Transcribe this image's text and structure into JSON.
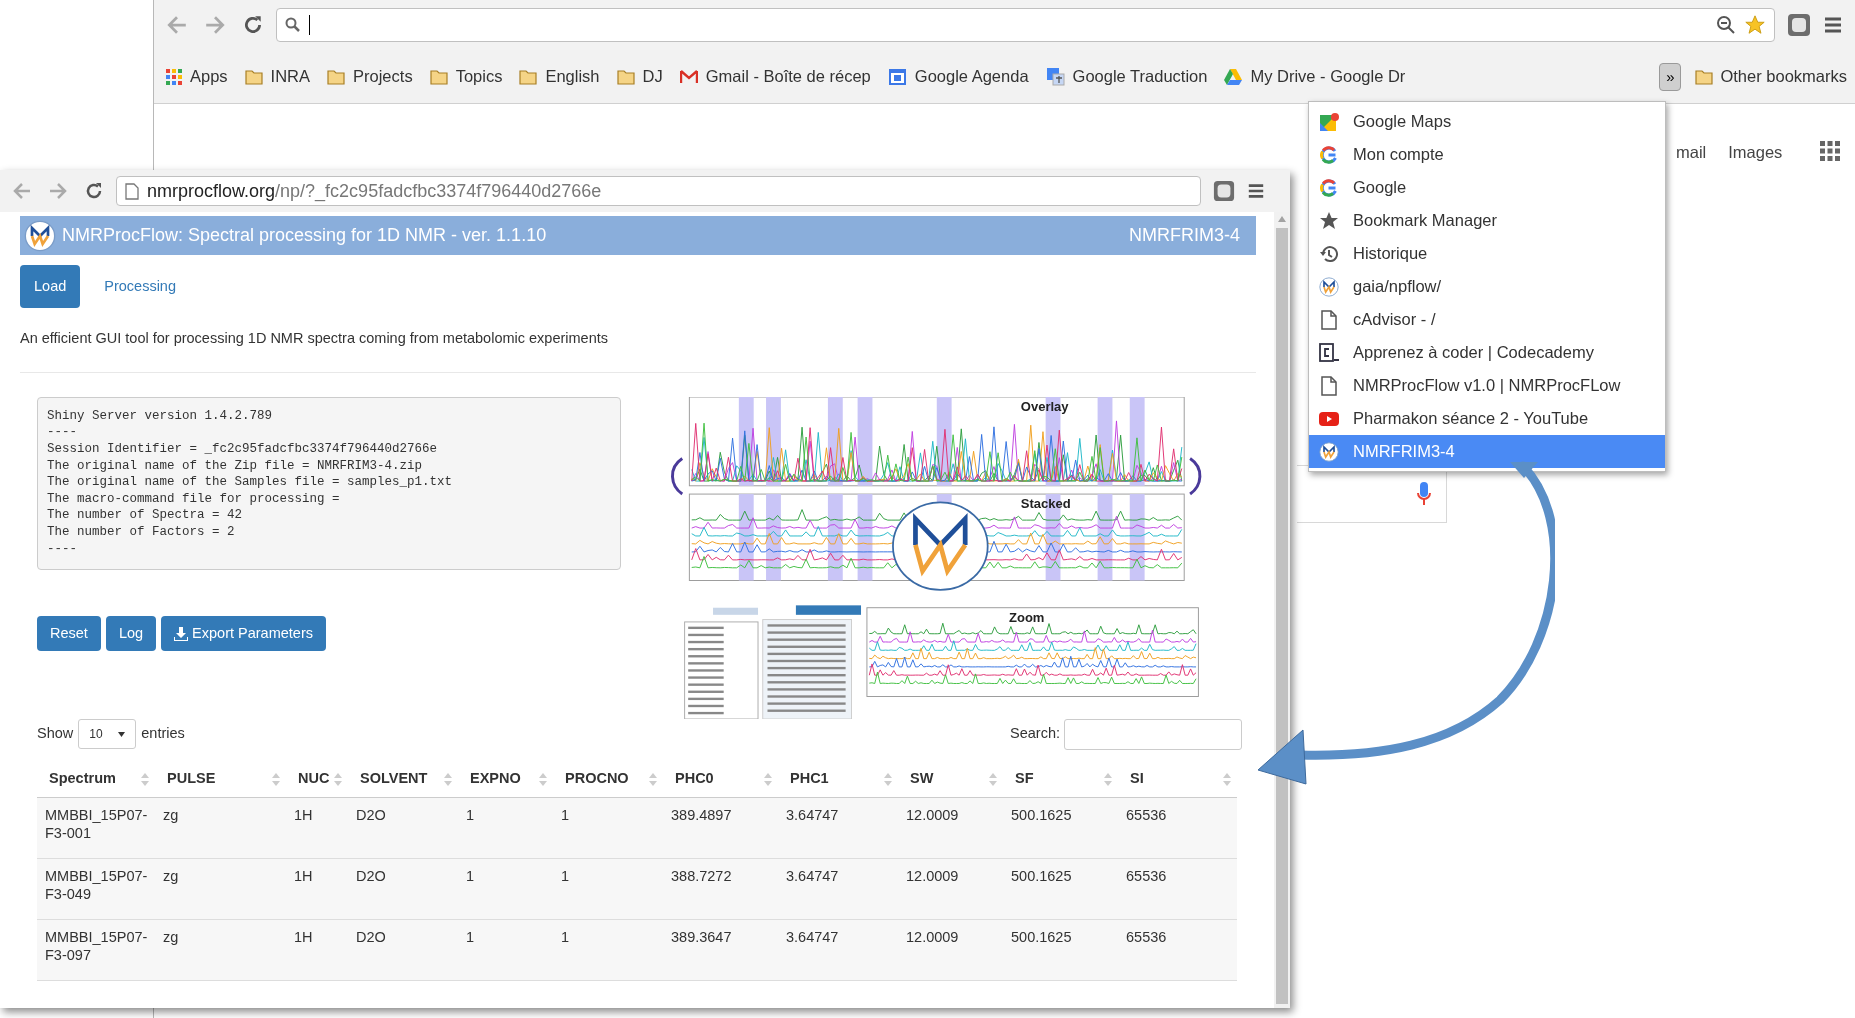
{
  "back_browser": {
    "bookmarks": [
      {
        "label": "Apps",
        "kind": "apps"
      },
      {
        "label": "INRA",
        "kind": "folder"
      },
      {
        "label": "Projects",
        "kind": "folder"
      },
      {
        "label": "Topics",
        "kind": "folder"
      },
      {
        "label": "English",
        "kind": "folder"
      },
      {
        "label": "DJ",
        "kind": "folder"
      },
      {
        "label": "Gmail - Boîte de récep",
        "kind": "gmail"
      },
      {
        "label": "Google Agenda",
        "kind": "calendar"
      },
      {
        "label": "Google Traduction",
        "kind": "translate"
      },
      {
        "label": "My Drive - Google Dr",
        "kind": "drive"
      }
    ],
    "overflow_button": "»",
    "other_bookmarks": "Other bookmarks",
    "page_links": [
      "mail",
      "Images"
    ]
  },
  "bookmark_menu": {
    "items": [
      {
        "label": "Google Maps",
        "kind": "maps",
        "selected": false
      },
      {
        "label": "Mon compte",
        "kind": "google",
        "selected": false
      },
      {
        "label": "Google",
        "kind": "google",
        "selected": false
      },
      {
        "label": "Bookmark Manager",
        "kind": "star",
        "selected": false
      },
      {
        "label": "Historique",
        "kind": "history",
        "selected": false
      },
      {
        "label": "gaia/npflow/",
        "kind": "logo",
        "selected": false
      },
      {
        "label": "cAdvisor - /",
        "kind": "page",
        "selected": false
      },
      {
        "label": "Apprenez à coder | Codecademy",
        "kind": "codecademy",
        "selected": false
      },
      {
        "label": "NMRProcFlow v1.0 | NMRProcFLow",
        "kind": "page",
        "selected": false
      },
      {
        "label": "Pharmakon séance 2 - YouTube",
        "kind": "youtube",
        "selected": false
      },
      {
        "label": "NMRFRIM3-4",
        "kind": "logo",
        "selected": true
      }
    ]
  },
  "front_browser": {
    "url_host": "nmrprocflow.org",
    "url_path": "/np/?_fc2c95fadcfbc3374f796440d2766e"
  },
  "app": {
    "title": "NMRProcFlow: Spectral processing for 1D NMR - ver. 1.1.10",
    "dataset": "NMRFRIM3-4",
    "tabs": [
      {
        "label": "Load",
        "selected": true
      },
      {
        "label": "Processing",
        "selected": false
      }
    ],
    "description": "An efficient GUI tool for processing 1D NMR spectra coming from metabolomic experiments",
    "log_lines": [
      "Shiny Server version 1.4.2.789",
      "----",
      "Session Identifier = _fc2c95fadcfbc3374f796440d2766e",
      "The original name of the Zip file = NMRFRIM3-4.zip",
      "The original name of the Samples file = samples_p1.txt",
      "The macro-command file for processing =",
      "The number of Spectra = 42",
      "The number of Factors = 2",
      "----"
    ],
    "buttons": [
      {
        "label": "Reset",
        "kind": "plain"
      },
      {
        "label": "Log",
        "kind": "plain"
      },
      {
        "label": "Export Parameters",
        "kind": "download"
      }
    ],
    "figure": {
      "panels": [
        "Overlay",
        "Stacked",
        "Zoom"
      ]
    },
    "table": {
      "show_label": "Show",
      "page_size": "10",
      "entries_label": "entries",
      "search_label": "Search:",
      "columns": [
        "Spectrum",
        "PULSE",
        "NUC",
        "SOLVENT",
        "EXPNO",
        "PROCNO",
        "PHC0",
        "PHC1",
        "SW",
        "SF",
        "SI"
      ],
      "rows": [
        [
          "MMBBI_15P07-F3-001",
          "zg",
          "1H",
          "D2O",
          "1",
          "1",
          "389.4897",
          "3.64747",
          "12.0009",
          "500.1625",
          "65536"
        ],
        [
          "MMBBI_15P07-F3-049",
          "zg",
          "1H",
          "D2O",
          "1",
          "1",
          "388.7272",
          "3.64747",
          "12.0009",
          "500.1625",
          "65536"
        ],
        [
          "MMBBI_15P07-F3-097",
          "zg",
          "1H",
          "D2O",
          "1",
          "1",
          "389.3647",
          "3.64747",
          "12.0009",
          "500.1625",
          "65536"
        ]
      ]
    }
  }
}
